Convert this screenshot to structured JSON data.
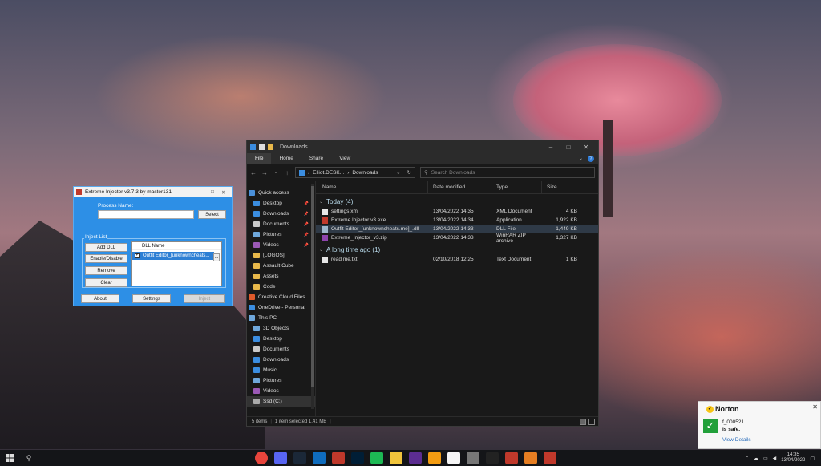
{
  "injector": {
    "title": "Extreme Injector v3.7.3 by master131",
    "process_name_label": "Process Name:",
    "process_name_value": "",
    "select_label": "Select",
    "inject_list_label": "Inject List",
    "add_dll_label": "Add DLL",
    "enable_disable_label": "Enable/Disable",
    "remove_label": "Remove",
    "clear_label": "Clear",
    "dll_column_header": "DLL Name",
    "dll_items": [
      {
        "name": "Outfit Editor_[unknowncheats...",
        "checked": true,
        "more": "..."
      }
    ],
    "about_label": "About",
    "settings_label": "Settings",
    "inject_label": "Inject",
    "inject_enabled": false
  },
  "explorer": {
    "title": "Downloads",
    "ribbon_tabs": [
      "File",
      "Home",
      "Share",
      "View"
    ],
    "address": {
      "segments": [
        "Elliot.DESK...",
        "Downloads"
      ],
      "separator": "›"
    },
    "search_placeholder": "Search Downloads",
    "nav": [
      {
        "label": "Quick access",
        "icon": "star-icon",
        "color": "#4a90d9",
        "pinned": false
      },
      {
        "label": "Desktop",
        "icon": "desktop-icon",
        "color": "#3b8de0",
        "pinned": true
      },
      {
        "label": "Downloads",
        "icon": "download-icon",
        "color": "#3b8de0",
        "pinned": true
      },
      {
        "label": "Documents",
        "icon": "documents-icon",
        "color": "#c9c9c9",
        "pinned": true
      },
      {
        "label": "Pictures",
        "icon": "pictures-icon",
        "color": "#6fa8dc",
        "pinned": true
      },
      {
        "label": "Videos",
        "icon": "videos-icon",
        "color": "#9b59b6",
        "pinned": true
      },
      {
        "label": "[LOGOS]",
        "icon": "folder-icon",
        "color": "#e8b84a",
        "pinned": false
      },
      {
        "label": "Assault Cube",
        "icon": "folder-icon",
        "color": "#e8b84a",
        "pinned": false
      },
      {
        "label": "Assets",
        "icon": "folder-icon",
        "color": "#e8b84a",
        "pinned": false
      },
      {
        "label": "Code",
        "icon": "folder-icon",
        "color": "#e8b84a",
        "pinned": false
      },
      {
        "label": "Creative Cloud Files",
        "icon": "creative-cloud-icon",
        "color": "#e05a2b",
        "pinned": false
      },
      {
        "label": "OneDrive - Personal",
        "icon": "cloud-icon",
        "color": "#3b8de0",
        "pinned": false
      },
      {
        "label": "This PC",
        "icon": "computer-icon",
        "color": "#6fa8dc",
        "pinned": false
      },
      {
        "label": "3D Objects",
        "icon": "cube-icon",
        "color": "#6fa8dc",
        "pinned": false
      },
      {
        "label": "Desktop",
        "icon": "desktop-icon",
        "color": "#3b8de0",
        "pinned": false
      },
      {
        "label": "Documents",
        "icon": "documents-icon",
        "color": "#c9c9c9",
        "pinned": false
      },
      {
        "label": "Downloads",
        "icon": "download-icon",
        "color": "#3b8de0",
        "pinned": false
      },
      {
        "label": "Music",
        "icon": "music-icon",
        "color": "#3b8de0",
        "pinned": false
      },
      {
        "label": "Pictures",
        "icon": "pictures-icon",
        "color": "#6fa8dc",
        "pinned": false
      },
      {
        "label": "Videos",
        "icon": "videos-icon",
        "color": "#9b59b6",
        "pinned": false
      },
      {
        "label": "Ssd (C:)",
        "icon": "drive-icon",
        "color": "#aaaaaa",
        "pinned": false
      }
    ],
    "columns": [
      "Name",
      "Date modified",
      "Type",
      "Size"
    ],
    "groups": [
      {
        "label": "Today (4)",
        "files": [
          {
            "name": "settings.xml",
            "date": "13/04/2022 14:35",
            "type": "XML Document",
            "size": "4 KB",
            "icon": "xml-file-icon",
            "color": "#e6e6e6",
            "selected": false
          },
          {
            "name": "Extreme Injector v3.exe",
            "date": "13/04/2022 14:34",
            "type": "Application",
            "size": "1,922 KB",
            "icon": "injector-app-icon",
            "color": "#c0392b",
            "selected": false
          },
          {
            "name": "Outfit Editor_[unknowncheats.me]_.dll",
            "date": "13/04/2022 14:33",
            "type": "DLL File",
            "size": "1,449 KB",
            "icon": "dll-file-icon",
            "color": "#9fb7cc",
            "selected": true
          },
          {
            "name": "Extreme_Injector_v3.zip",
            "date": "13/04/2022 14:33",
            "type": "WinRAR ZIP archive",
            "size": "1,327 KB",
            "icon": "winrar-archive-icon",
            "color": "#8e44ad",
            "selected": false
          }
        ]
      },
      {
        "label": "A long time ago (1)",
        "files": [
          {
            "name": "read me.txt",
            "date": "02/10/2018 12:25",
            "type": "Text Document",
            "size": "1 KB",
            "icon": "text-file-icon",
            "color": "#e6e6e6",
            "selected": false
          }
        ]
      }
    ],
    "status": {
      "count": "5 items",
      "selection": "1 item selected  1.41 MB"
    }
  },
  "taskbar": {
    "apps": [
      {
        "icon": "chrome-icon",
        "color": "#e8453c"
      },
      {
        "icon": "discord-icon",
        "color": "#5865f2"
      },
      {
        "icon": "steam-icon",
        "color": "#1b2838"
      },
      {
        "icon": "mail-icon",
        "color": "#0f6cbd"
      },
      {
        "icon": "outlook-icon",
        "color": "#c0392b"
      },
      {
        "icon": "photoshop-icon",
        "color": "#001e36"
      },
      {
        "icon": "spotify-icon",
        "color": "#1db954"
      },
      {
        "icon": "file-explorer-icon",
        "color": "#f0c43b"
      },
      {
        "icon": "visual-studio-icon",
        "color": "#5c2d91"
      },
      {
        "icon": "app-a-icon",
        "color": "#f39c12"
      },
      {
        "icon": "notepad-icon",
        "color": "#f5f5f5"
      },
      {
        "icon": "store-icon",
        "color": "#777777"
      },
      {
        "icon": "epic-games-icon",
        "color": "#222222"
      },
      {
        "icon": "recorder-icon",
        "color": "#c0392b"
      },
      {
        "icon": "game-icon",
        "color": "#e67e22"
      },
      {
        "icon": "injector-taskbar-icon",
        "color": "#c0392b"
      }
    ],
    "clock_time": "14:35",
    "clock_date": "13/04/2022"
  },
  "toast": {
    "brand": "Norton",
    "file": "f_000521",
    "message": "is safe.",
    "link": "View Details"
  }
}
